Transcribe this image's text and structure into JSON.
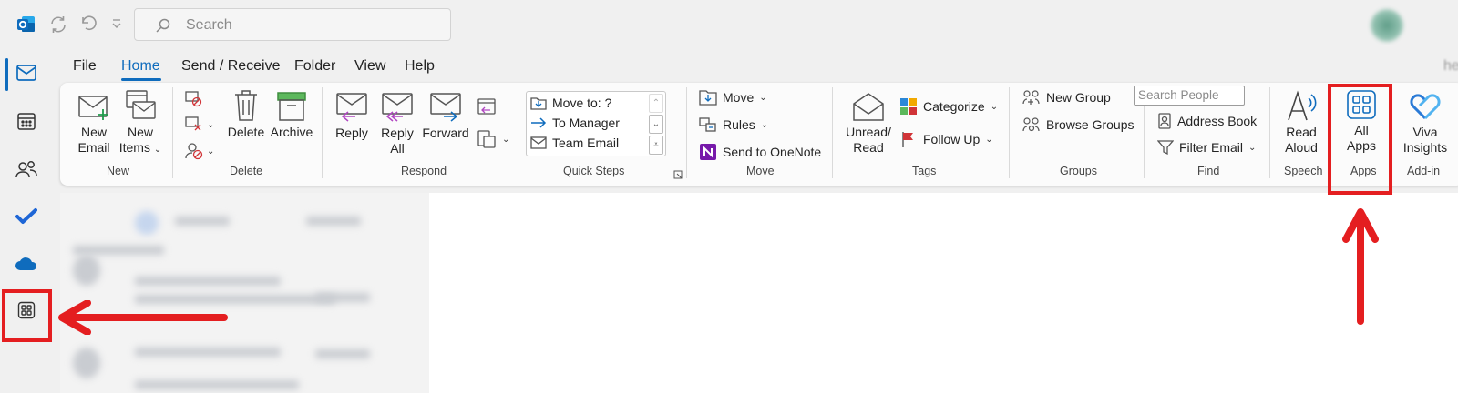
{
  "titlebar": {
    "search_placeholder": "Search"
  },
  "rail": {
    "items": [
      "mail",
      "calendar",
      "people",
      "to-do",
      "onedrive",
      "apps"
    ]
  },
  "menu": {
    "tabs": [
      "File",
      "Home",
      "Send / Receive",
      "Folder",
      "View",
      "Help"
    ],
    "active_tab": "Home",
    "overflow_text": "he"
  },
  "ribbon": {
    "new": {
      "new_email": "New Email",
      "new_email_l1": "New",
      "new_email_l2": "Email",
      "new_items_l1": "New",
      "new_items_l2": "Items",
      "group": "New"
    },
    "delete": {
      "delete": "Delete",
      "archive": "Archive",
      "group": "Delete"
    },
    "respond": {
      "reply": "Reply",
      "reply_all_l1": "Reply",
      "reply_all_l2": "All",
      "forward": "Forward",
      "group": "Respond"
    },
    "quick_steps": {
      "items": [
        "Move to: ?",
        "To Manager",
        "Team Email"
      ],
      "group": "Quick Steps"
    },
    "move": {
      "move": "Move",
      "rules": "Rules",
      "onenote": "Send to OneNote",
      "group": "Move"
    },
    "tags": {
      "unread_l1": "Unread/",
      "unread_l2": "Read",
      "categorize": "Categorize",
      "follow_up": "Follow Up",
      "group": "Tags"
    },
    "groups": {
      "new_group": "New Group",
      "browse_groups": "Browse Groups",
      "group": "Groups"
    },
    "find": {
      "search_people_placeholder": "Search People",
      "address_book": "Address Book",
      "filter_email": "Filter Email",
      "group": "Find"
    },
    "speech": {
      "read_l1": "Read",
      "read_l2": "Aloud",
      "group": "Speech"
    },
    "apps": {
      "all_l1": "All",
      "all_l2": "Apps",
      "group": "Apps"
    },
    "addin": {
      "viva_l1": "Viva",
      "viva_l2": "Insights",
      "group": "Add-in"
    }
  },
  "colors": {
    "accent": "#0f6cbd",
    "annotation_red": "#e41e20"
  }
}
